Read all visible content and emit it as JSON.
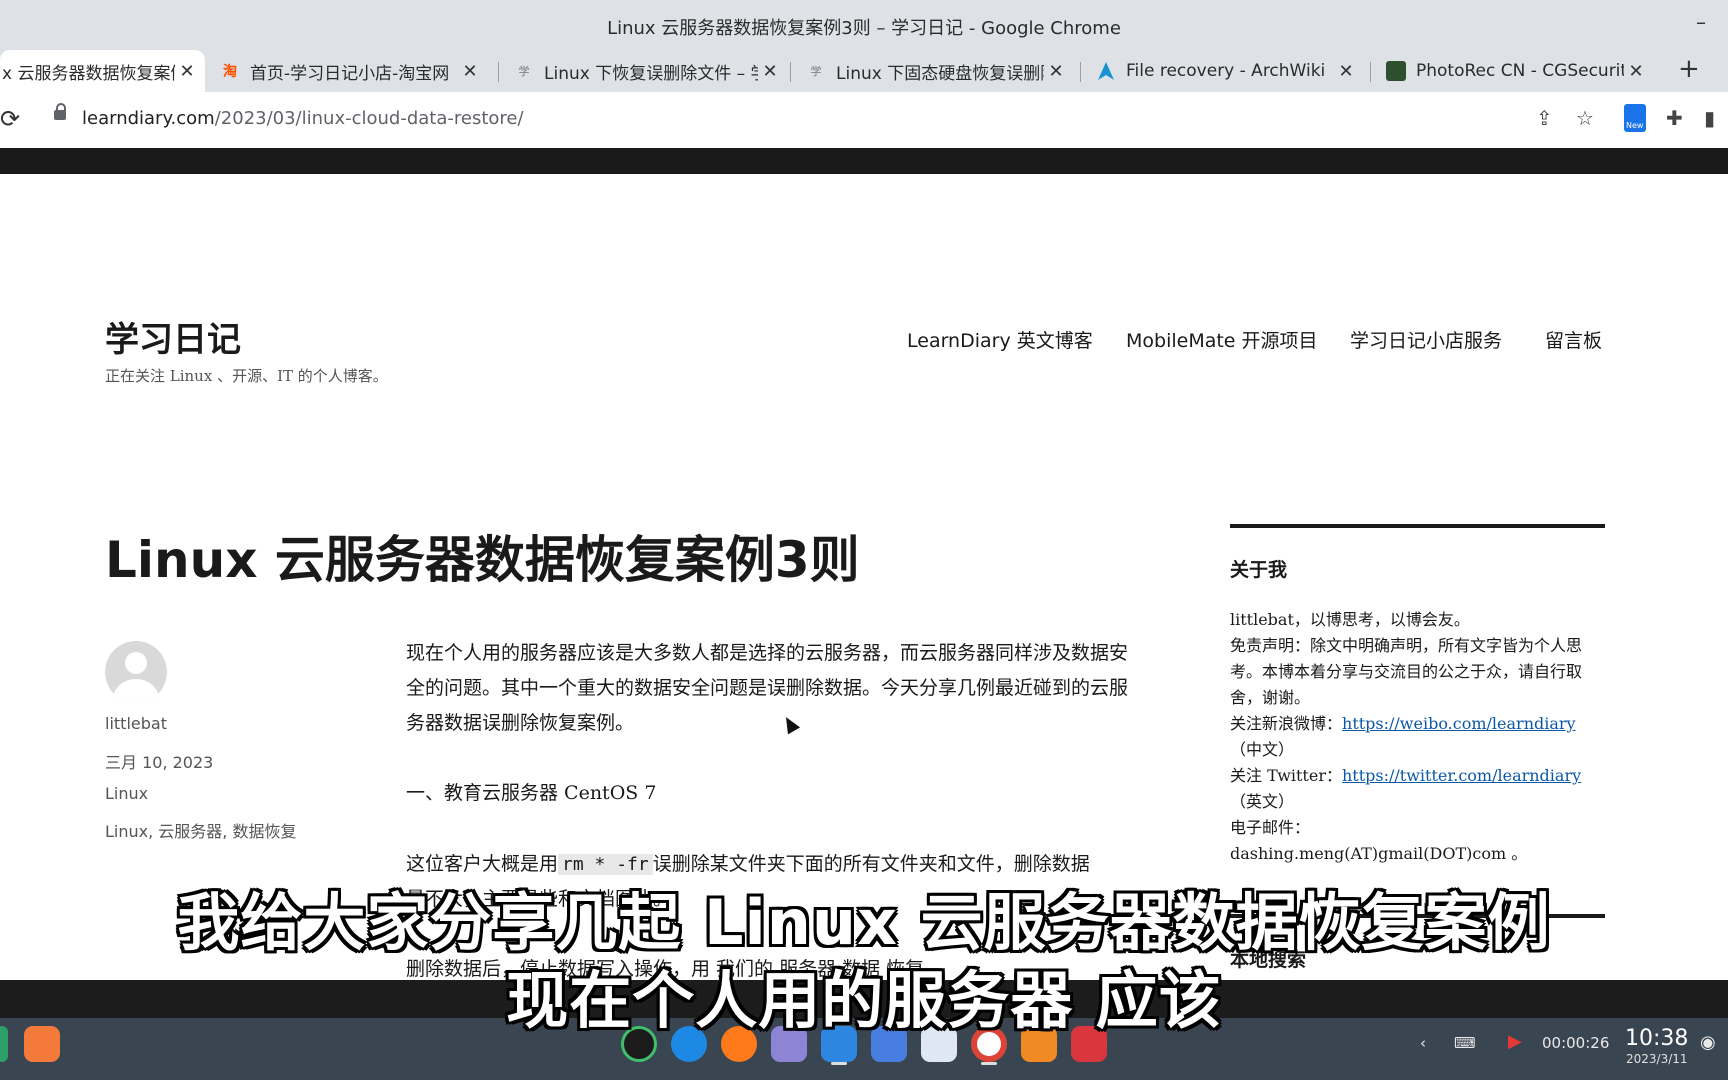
{
  "window": {
    "title": "Linux 云服务器数据恢复案例3则 – 学习日记 - Google Chrome",
    "minimize": "–"
  },
  "tabs": [
    {
      "label": "x 云服务器数据恢复案例",
      "icon": "page-icon",
      "active": true
    },
    {
      "label": "首页-学习日记小店-淘宝网",
      "icon": "taobao-icon"
    },
    {
      "label": "Linux 下恢复误删除文件 – 学",
      "icon": "learndiary-icon"
    },
    {
      "label": "Linux 下固态硬盘恢复误删除",
      "icon": "learndiary-icon"
    },
    {
      "label": "File recovery - ArchWiki",
      "icon": "archlinux-icon"
    },
    {
      "label": "PhotoRec CN - CGSecurity",
      "icon": "cgsecurity-icon"
    }
  ],
  "tab_close": "✕",
  "new_tab": "+",
  "address": {
    "host": "learndiary.com",
    "path": "/2023/03/linux-cloud-data-restore/"
  },
  "extension_badge": "New",
  "site": {
    "title": "学习日记",
    "description": "正在关注 Linux 、开源、IT 的个人博客。"
  },
  "nav": [
    "LearnDiary 英文博客",
    "MobileMate 开源项目",
    "学习日记小店服务",
    "留言板"
  ],
  "post": {
    "title": "Linux 云服务器数据恢复案例3则",
    "author": "littlebat",
    "date": "三月 10, 2023",
    "category": "Linux",
    "tags": "Linux, 云服务器, 数据恢复",
    "para1": "现在个人用的服务器应该是大多数人都是选择的云服务器，而云服务器同样涉及数据安全的问题。其中一个重大的数据安全问题是误删除数据。今天分享几例最近碰到的云服务器数据误删除恢复案例。",
    "heading1": "一、教育云服务器 CentOS 7",
    "para2_before": "这位客户大概是用",
    "para2_code": "rm * -fr",
    "para2_after": "误删除某文件夹下面的所有文件夹和文件，删除数据",
    "para2_line2": "量不大，主要是些和文档图片。",
    "para3": "删除数据后，停止数据写入操作，用 我们的 服务器 数据 恢复"
  },
  "sidebar": {
    "about_title": "关于我",
    "about_line1": "littlebat，以博思考，以博会友。",
    "disclaimer": "免责声明：除文中明确声明，所有文字皆为个人思考。本博本着分享与交流目的公之于众，请自行取舍，谢谢。",
    "weibo_label": "关注新浪微博：",
    "weibo_url": "https://weibo.com/learndiary",
    "weibo_suffix": "（中文）",
    "twitter_label": "关注 Twitter：",
    "twitter_url": "https://twitter.com/learndiary",
    "twitter_suffix": "（英文）",
    "email": "电子邮件： dashing.meng(AT)gmail(DOT)com 。",
    "search_title": "本地搜索"
  },
  "subtitles": {
    "line1": "我给大家分享几起 Linux 云服务器数据恢复案例",
    "line2": "现在个人用的服务器 应该"
  },
  "taskbar": {
    "recording_time": "00:00:26",
    "clock": "10:38",
    "date": "2023/3/11"
  },
  "colors": {
    "link": "#0b57a8",
    "taskbar": "#3a4552",
    "tab_strip": "#dee1e6"
  }
}
